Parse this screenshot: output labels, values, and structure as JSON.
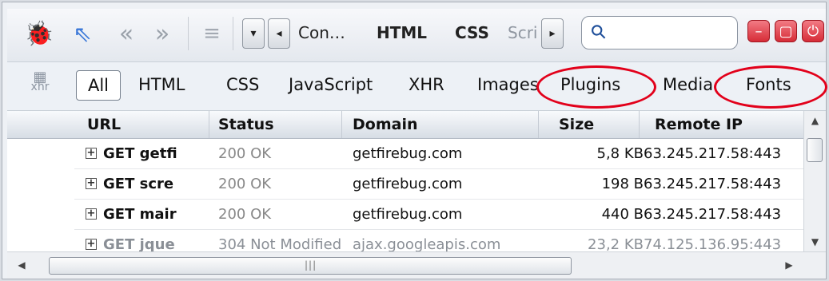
{
  "toolbar": {
    "firebug_icon": "firebug-icon",
    "inspect_icon": "inspect-icon",
    "back_icon": "double-left-icon",
    "forward_icon": "double-right-icon",
    "list_icon": "list-icon",
    "dropdown_symbol": "▾",
    "left_symbol": "◂",
    "right_symbol": "▸",
    "tabs": [
      "Con…",
      "HTML",
      "CSS",
      "Scri"
    ],
    "search_placeholder": "",
    "window_buttons": [
      "–",
      "▢",
      "⏻"
    ]
  },
  "filters": {
    "xhr_icon_label": "xhr",
    "tabs": [
      "All",
      "HTML",
      "CSS",
      "JavaScript",
      "XHR",
      "Images",
      "Plugins",
      "Media",
      "Fonts"
    ]
  },
  "table": {
    "headers": [
      "URL",
      "Status",
      "Domain",
      "Size",
      "Remote IP"
    ],
    "rows": [
      {
        "url": "GET getfi",
        "status": "200 OK",
        "domain": "getfirebug.com",
        "size": "5,8 KB",
        "ip": "63.245.217.58:443"
      },
      {
        "url": "GET scre",
        "status": "200 OK",
        "domain": "getfirebug.com",
        "size": "198 B",
        "ip": "63.245.217.58:443"
      },
      {
        "url": "GET mair",
        "status": "200 OK",
        "domain": "getfirebug.com",
        "size": "440 B",
        "ip": "63.245.217.58:443"
      },
      {
        "url": "GET jque",
        "status": "304 Not Modified",
        "domain": "ajax.googleapis.com",
        "size": "23,2 KB",
        "ip": "74.125.136.95:443"
      }
    ]
  },
  "colors": {
    "annotation": "#e2001a",
    "highlight_tab_border": "#78828f"
  }
}
